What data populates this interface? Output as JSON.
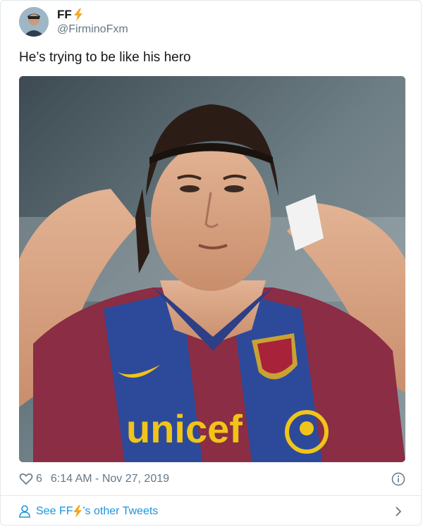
{
  "tweet": {
    "display_name": "FF",
    "handle": "@FirminoFxm",
    "text": "He’s trying to be like his hero",
    "like_count": "6",
    "timestamp": "6:14 AM - Nov 27, 2019"
  },
  "footer": {
    "prefix": "See FF",
    "suffix": "'s other Tweets"
  },
  "icons": {
    "bolt": "lightning-bolt-icon",
    "heart": "heart-icon",
    "info": "info-icon",
    "person": "person-icon",
    "chevron": "chevron-right-icon"
  },
  "colors": {
    "link": "#1b95e0",
    "muted": "#657786",
    "text": "#14171a",
    "bolt": "#f5a623"
  }
}
